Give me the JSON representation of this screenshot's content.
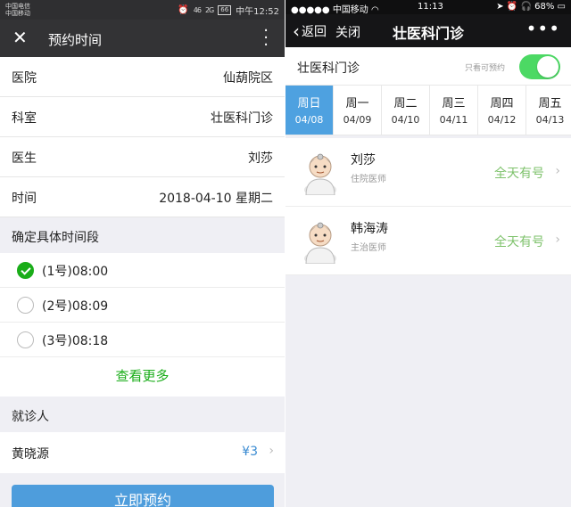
{
  "left": {
    "status": {
      "carrier1": "中国电信",
      "carrier2": "中国移动",
      "signal_a": "46",
      "signal_b": "2G",
      "battery": "66",
      "time": "中午12:52"
    },
    "nav": {
      "close_icon": "close-icon",
      "title": "预约时间",
      "more_icon": "more-vertical-icon"
    },
    "info": [
      {
        "key": "医院",
        "value": "仙葫院区"
      },
      {
        "key": "科室",
        "value": "壮医科门诊"
      },
      {
        "key": "医生",
        "value": "刘莎"
      },
      {
        "key": "时间",
        "value": "2018-04-10 星期二"
      }
    ],
    "slot_section": "确定具体时间段",
    "slots": [
      {
        "label": "(1号)08:00",
        "checked": true
      },
      {
        "label": "(2号)08:09",
        "checked": false
      },
      {
        "label": "(3号)08:18",
        "checked": false
      }
    ],
    "more_label": "查看更多",
    "patient_section": "就诊人",
    "patient": {
      "name": "黄晓源",
      "price": "¥3"
    },
    "book_label": "立即预约",
    "colors": {
      "accent_green": "#1aad19",
      "button_blue": "#4e9ddc"
    }
  },
  "right": {
    "status": {
      "carrier": "中国移动",
      "time": "11:13",
      "battery": "68%"
    },
    "nav": {
      "back": "返回",
      "close": "关闭",
      "title": "壮医科门诊",
      "more_icon": "more-dots-icon"
    },
    "dept": "壮医科门诊",
    "only_available_label": "只看可预约",
    "toggle_on": true,
    "days": [
      {
        "weekday": "周日",
        "date": "04/08",
        "active": true
      },
      {
        "weekday": "周一",
        "date": "04/09",
        "active": false
      },
      {
        "weekday": "周二",
        "date": "04/10",
        "active": false
      },
      {
        "weekday": "周三",
        "date": "04/11",
        "active": false
      },
      {
        "weekday": "周四",
        "date": "04/12",
        "active": false
      },
      {
        "weekday": "周五",
        "date": "04/13",
        "active": false
      }
    ],
    "doctors": [
      {
        "name": "刘莎",
        "title": "住院医师",
        "availability": "全天有号"
      },
      {
        "name": "韩海涛",
        "title": "主治医师",
        "availability": "全天有号"
      }
    ],
    "colors": {
      "active_day": "#4ea1e0",
      "toggle": "#4cd964",
      "available": "#7ec26b"
    }
  }
}
